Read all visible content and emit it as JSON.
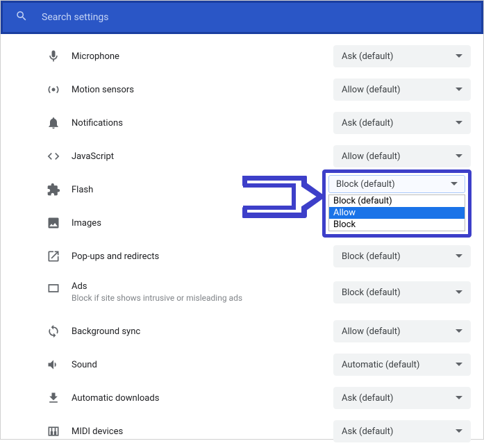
{
  "search": {
    "placeholder": "Search settings"
  },
  "rows": [
    {
      "label": "Microphone",
      "value": "Ask (default)"
    },
    {
      "label": "Motion sensors",
      "value": "Allow (default)"
    },
    {
      "label": "Notifications",
      "value": "Ask (default)"
    },
    {
      "label": "JavaScript",
      "value": "Allow (default)"
    },
    {
      "label": "Flash",
      "value": ""
    },
    {
      "label": "Images",
      "value": ""
    },
    {
      "label": "Pop-ups and redirects",
      "value": "Block (default)"
    },
    {
      "label": "Ads",
      "sublabel": "Block if site shows intrusive or misleading ads",
      "value": "Block (default)"
    },
    {
      "label": "Background sync",
      "value": "Allow (default)"
    },
    {
      "label": "Sound",
      "value": "Automatic (default)"
    },
    {
      "label": "Automatic downloads",
      "value": "Ask (default)"
    },
    {
      "label": "MIDI devices",
      "value": "Ask (default)"
    }
  ],
  "flash_open": {
    "selected": "Block (default)",
    "options": [
      "Block (default)",
      "Allow",
      "Block"
    ],
    "highlighted": "Allow"
  }
}
